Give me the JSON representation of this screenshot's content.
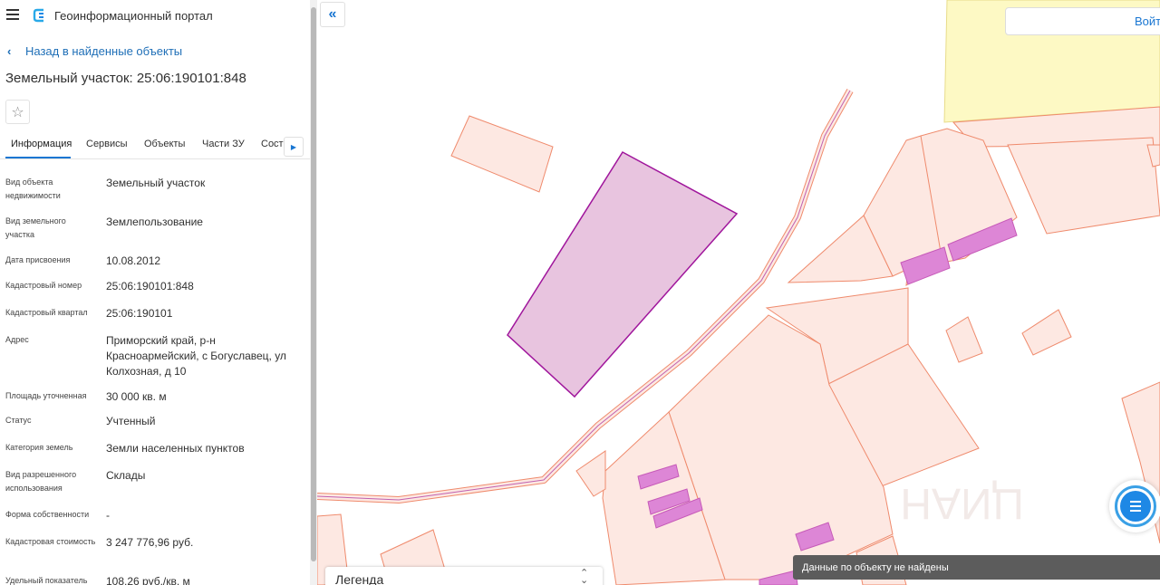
{
  "header": {
    "app_title": "Геоинформационный портал",
    "menu_icon": "hamburger-menu-icon",
    "logo_icon": "portal-logo-icon"
  },
  "navigation": {
    "back_label": "Назад в найденные объекты"
  },
  "object": {
    "title": "Земельный участок: 25:06:190101:848"
  },
  "tabs": [
    {
      "label": "Информация",
      "active": true
    },
    {
      "label": "Сервисы",
      "active": false
    },
    {
      "label": "Объекты",
      "active": false
    },
    {
      "label": "Части ЗУ",
      "active": false
    },
    {
      "label": "Соста",
      "active": false
    }
  ],
  "info_rows": [
    {
      "label": "Вид объекта недвижимости",
      "value": "Земельный участок"
    },
    {
      "label": "Вид земельного участка",
      "value": "Землепользование"
    },
    {
      "label": "Дата присвоения",
      "value": "10.08.2012"
    },
    {
      "label": "Кадастровый номер",
      "value": "25:06:190101:848"
    },
    {
      "label": "Кадастровый квартал",
      "value": "25:06:190101"
    },
    {
      "label": "Адрес",
      "value": "Приморский край, р-н Красноармейский, с Богуславец, ул Колхозная, д 10"
    },
    {
      "label": "Площадь уточненная",
      "value": "30 000 кв. м"
    },
    {
      "label": "Статус",
      "value": "Учтенный"
    },
    {
      "label": "Категория земель",
      "value": "Земли населенных пунктов"
    },
    {
      "label": "Вид разрешенного использования",
      "value": "Склады"
    },
    {
      "label": "Форма собственности",
      "value": "-"
    },
    {
      "label": "Кадастровая стоимость",
      "value": "3 247 776,96 руб."
    },
    {
      "label": "Удельный показатель",
      "value": "108,26 руб./кв. м"
    }
  ],
  "map": {
    "login_label": "Войти",
    "legend_title": "Легенда",
    "toast_message": "Данные по объекту не найдены",
    "watermark": "ЦИАН",
    "colors": {
      "parcel_fill": "#fde8e2",
      "parcel_stroke": "#ef8a6c",
      "selected_fill": "#e8c4df",
      "selected_stroke": "#a0169c",
      "building_fill": "#dd86d6",
      "zone_fill": "#fdf9c4",
      "accent": "#1976d2"
    }
  }
}
